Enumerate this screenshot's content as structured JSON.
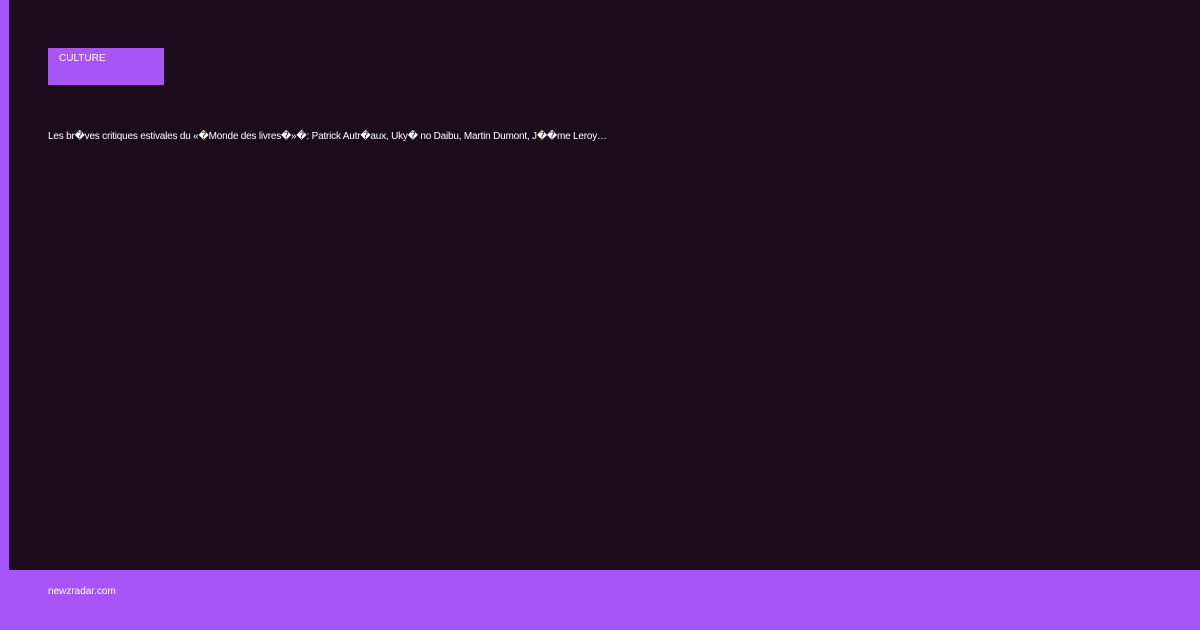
{
  "category": {
    "label": "CULTURE"
  },
  "article": {
    "headline": "Les br�ves critiques estivales du «�Monde des livres�»�: Patrick Autr�aux, Uky� no Daibu, Martin Dumont, J��me Leroy…"
  },
  "footer": {
    "domain": "newzradar.com"
  },
  "colors": {
    "background": "#1b0b1b",
    "accent": "#a855f7",
    "text": "#ffffff"
  }
}
